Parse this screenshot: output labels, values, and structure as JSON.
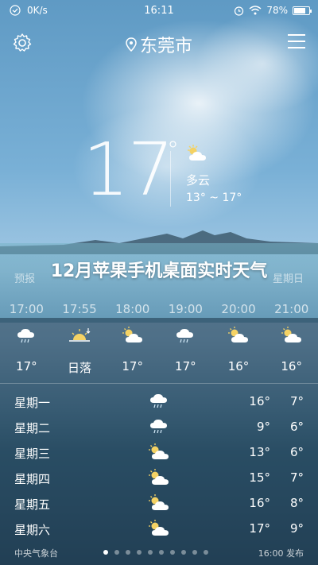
{
  "status_bar": {
    "speed": "0K/s",
    "time": "16:11",
    "battery": "78%",
    "battery_level": 0.78
  },
  "header": {
    "city": "东莞市",
    "settings_icon": "gear-icon",
    "location_icon": "location-pin-icon",
    "menu_icon": "menu-icon"
  },
  "current": {
    "temp": "17",
    "degree": "°",
    "condition": "多云",
    "range": "13° ~ 17°",
    "icon": "partly-cloudy-icon"
  },
  "hourly": {
    "title_left": "预报",
    "title_right": "星期日",
    "times": [
      "17:00",
      "17:55",
      "18:00",
      "19:00",
      "20:00",
      "21:00"
    ],
    "icons": [
      "rain-cloud-icon",
      "sunset-icon",
      "partly-cloudy-icon",
      "rain-cloud-icon",
      "partly-cloudy-icon",
      "partly-cloudy-icon"
    ],
    "temps": [
      "17°",
      "日落",
      "17°",
      "17°",
      "16°",
      "16°"
    ]
  },
  "overlay_title": "12月苹果手机桌面实时天气",
  "daily": [
    {
      "day": "星期一",
      "icon": "rain-cloud-icon",
      "hi": "16°",
      "lo": "7°"
    },
    {
      "day": "星期二",
      "icon": "rain-cloud-icon",
      "hi": "9°",
      "lo": "6°"
    },
    {
      "day": "星期三",
      "icon": "partly-cloudy-icon",
      "hi": "13°",
      "lo": "6°"
    },
    {
      "day": "星期四",
      "icon": "partly-cloudy-icon",
      "hi": "15°",
      "lo": "7°"
    },
    {
      "day": "星期五",
      "icon": "partly-cloudy-icon",
      "hi": "16°",
      "lo": "8°"
    },
    {
      "day": "星期六",
      "icon": "partly-cloudy-icon",
      "hi": "17°",
      "lo": "9°"
    }
  ],
  "footer": {
    "source": "中央气象台",
    "publish": "16:00 发布",
    "page_count": 10,
    "active_page": 0
  },
  "colors": {
    "sun": "#f4d264",
    "cloud": "#ffffff",
    "rain": "#cfe6f5"
  }
}
